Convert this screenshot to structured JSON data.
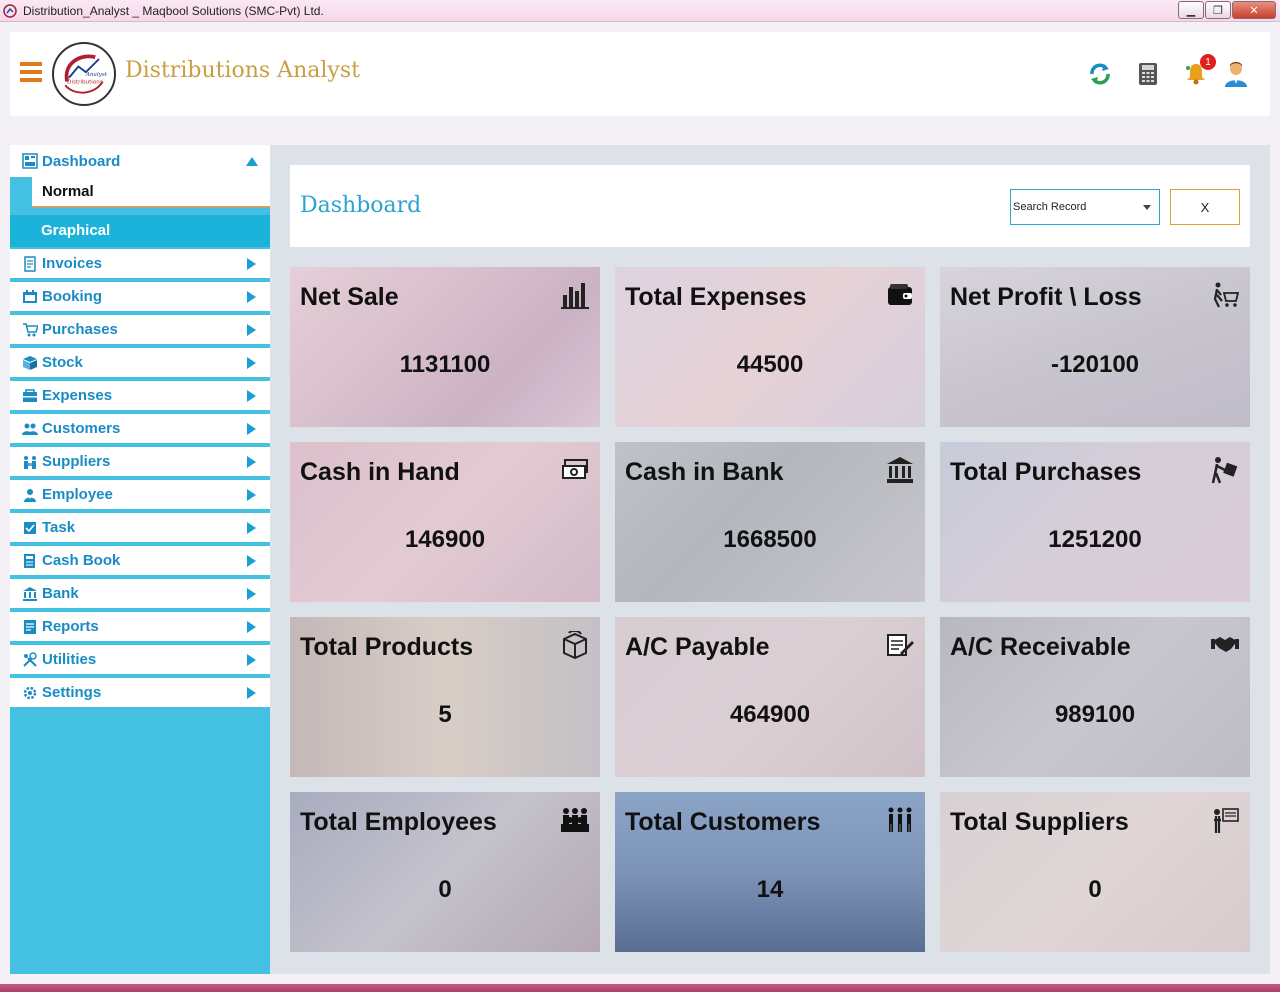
{
  "window": {
    "title": "Distribution_Analyst _ Maqbool Solutions (SMC-Pvt) Ltd."
  },
  "header": {
    "app_name": "Distributions Analyst",
    "logo_text_top": "Analyst",
    "logo_text_bottom": "Distributions",
    "notification_count": "1",
    "icons": [
      "menu-icon",
      "refresh-icon",
      "calculator-icon",
      "bell-icon",
      "user-icon"
    ]
  },
  "sidebar": {
    "dashboard": {
      "label": "Dashboard",
      "icon": "dashboard-icon"
    },
    "sub_items": [
      {
        "label": "Normal"
      },
      {
        "label": "Graphical"
      }
    ],
    "items": [
      {
        "label": "Invoices",
        "icon": "invoice-icon"
      },
      {
        "label": "Booking",
        "icon": "booking-icon"
      },
      {
        "label": "Purchases",
        "icon": "cart-icon"
      },
      {
        "label": "Stock",
        "icon": "stock-icon"
      },
      {
        "label": "Expenses",
        "icon": "expenses-icon"
      },
      {
        "label": "Customers",
        "icon": "customers-icon"
      },
      {
        "label": "Suppliers",
        "icon": "suppliers-icon"
      },
      {
        "label": "Employee",
        "icon": "employee-icon"
      },
      {
        "label": "Task",
        "icon": "task-icon"
      },
      {
        "label": "Cash Book",
        "icon": "cashbook-icon"
      },
      {
        "label": "Bank",
        "icon": "bank-icon"
      },
      {
        "label": "Reports",
        "icon": "reports-icon"
      },
      {
        "label": "Utilities",
        "icon": "utilities-icon"
      },
      {
        "label": "Settings",
        "icon": "settings-icon"
      }
    ]
  },
  "main": {
    "title": "Dashboard",
    "search": {
      "value": "Search Record"
    },
    "clear_label": "X",
    "cards": [
      {
        "title": "Net Sale",
        "value": "1131100",
        "icon": "bar-chart-icon"
      },
      {
        "title": "Total Expenses",
        "value": "44500",
        "icon": "wallet-icon"
      },
      {
        "title": "Net Profit \\ Loss",
        "value": "-120100",
        "icon": "shopper-cart-icon"
      },
      {
        "title": "Cash in Hand",
        "value": "146900",
        "icon": "cash-stack-icon"
      },
      {
        "title": "Cash in Bank",
        "value": "1668500",
        "icon": "bank-building-icon"
      },
      {
        "title": "Total Purchases",
        "value": "1251200",
        "icon": "person-box-icon"
      },
      {
        "title": "Total Products",
        "value": "5",
        "icon": "product-box-icon"
      },
      {
        "title": "A/C Payable",
        "value": "464900",
        "icon": "payable-doc-icon"
      },
      {
        "title": "A/C Receivable",
        "value": "989100",
        "icon": "handshake-icon"
      },
      {
        "title": "Total Employees",
        "value": "0",
        "icon": "group-icon"
      },
      {
        "title": "Total Customers",
        "value": "14",
        "icon": "people-icon"
      },
      {
        "title": "Total Suppliers",
        "value": "0",
        "icon": "supplier-board-icon"
      }
    ]
  }
}
